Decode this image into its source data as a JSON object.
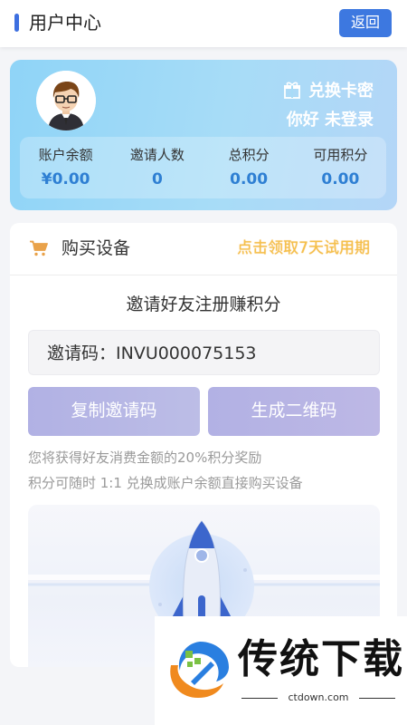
{
  "header": {
    "title": "用户中心",
    "back_label": "返回"
  },
  "user_card": {
    "redeem_label": "兑换卡密",
    "redeem_icon": "gift-icon",
    "greeting": "你好 未登录",
    "stats": [
      {
        "label": "账户余额",
        "value": "¥0.00"
      },
      {
        "label": "邀请人数",
        "value": "0"
      },
      {
        "label": "总积分",
        "value": "0.00"
      },
      {
        "label": "可用积分",
        "value": "0.00"
      }
    ]
  },
  "buy": {
    "icon": "cart-icon",
    "label": "购买设备",
    "trial_link": "点击领取7天试用期"
  },
  "invite": {
    "title": "邀请好友注册赚积分",
    "code_text": "邀请码：INVU000075153",
    "copy_button": "复制邀请码",
    "qr_button": "生成二维码",
    "note1": "您将获得好友消费金额的20%积分奖励",
    "note2": "积分可随时 1:1 兑换成账户余额直接购买设备"
  },
  "watermark": {
    "text": "传统下载",
    "domain": "ctdown.com"
  },
  "colors": {
    "accent": "#3d78e0",
    "stat_value": "#2e7fd3",
    "trial_link": "#f5c14a",
    "button": "#b5b4e5"
  }
}
